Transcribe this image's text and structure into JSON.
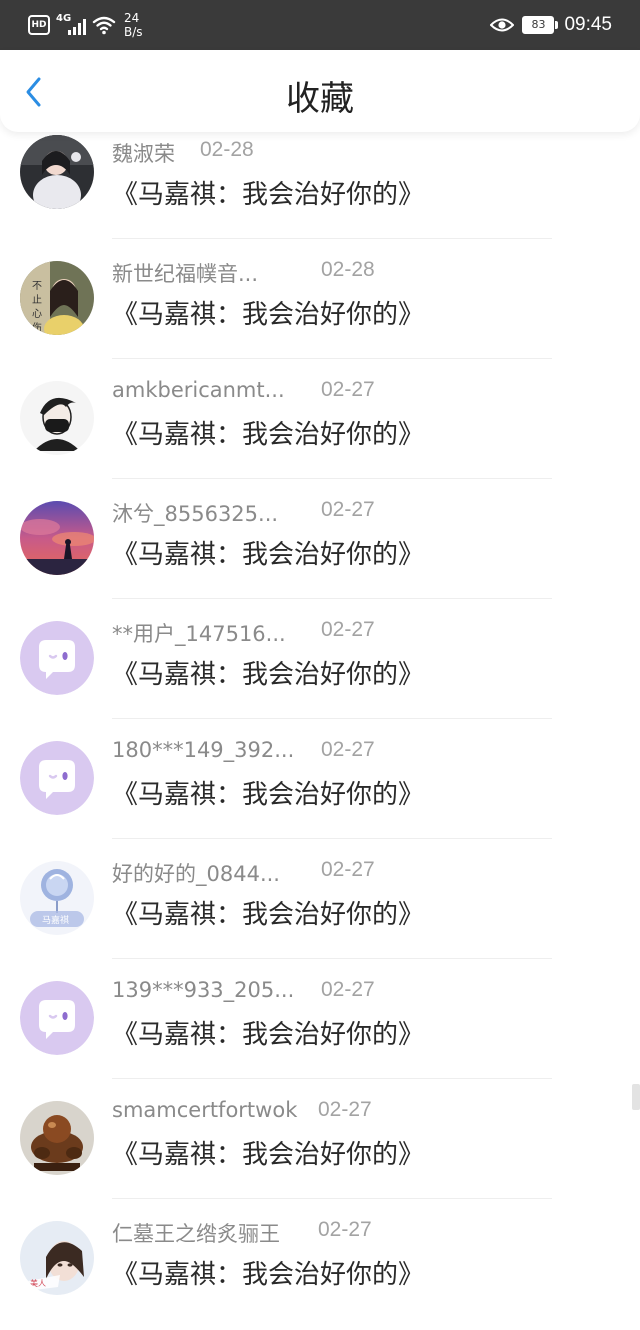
{
  "status_bar": {
    "hd_badge": "HD",
    "network": "4G",
    "speed_value": "24",
    "speed_unit": "B/s",
    "battery": "83",
    "time": "09:45",
    "icons": [
      "hd-icon",
      "signal-icon",
      "wifi-icon",
      "eye-icon",
      "battery-icon"
    ]
  },
  "header": {
    "title": "收藏",
    "back_icon": "chevron-left-icon",
    "accent_color": "#2b8de3"
  },
  "items": [
    {
      "user": "魏淑荣",
      "date": "02-28",
      "title": "《马嘉祺：我会治好你的》",
      "avatar": "photo"
    },
    {
      "user": "新世纪福幞音...",
      "date": "02-28",
      "title": "《马嘉祺：我会治好你的》",
      "avatar": "photo"
    },
    {
      "user": "amkbericanmt...",
      "date": "02-27",
      "title": "《马嘉祺：我会治好你的》",
      "avatar": "photo"
    },
    {
      "user": "沐兮_8556325...",
      "date": "02-27",
      "title": "《马嘉祺：我会治好你的》",
      "avatar": "photo"
    },
    {
      "user": "**用户_147516...",
      "date": "02-27",
      "title": "《马嘉祺：我会治好你的》",
      "avatar": "default-chat-icon"
    },
    {
      "user": "180***149_392...",
      "date": "02-27",
      "title": "《马嘉祺：我会治好你的》",
      "avatar": "default-chat-icon"
    },
    {
      "user": "好的好的_0844...",
      "date": "02-27",
      "title": "《马嘉祺：我会治好你的》",
      "avatar": "photo"
    },
    {
      "user": "139***933_205...",
      "date": "02-27",
      "title": "《马嘉祺：我会治好你的》",
      "avatar": "default-chat-icon"
    },
    {
      "user": "smamcertfortwok",
      "date": "02-27",
      "title": "《马嘉祺：我会治好你的》",
      "avatar": "photo"
    },
    {
      "user": "仁墓王之绺炙骊王",
      "date": "02-27",
      "title": "《马嘉祺：我会治好你的》",
      "avatar": "photo"
    }
  ],
  "colors": {
    "status_bar_bg": "#3a3a3a",
    "default_avatar": "#d9c9f0",
    "username": "#8a8a8a",
    "title_text": "#2a2a2a"
  }
}
